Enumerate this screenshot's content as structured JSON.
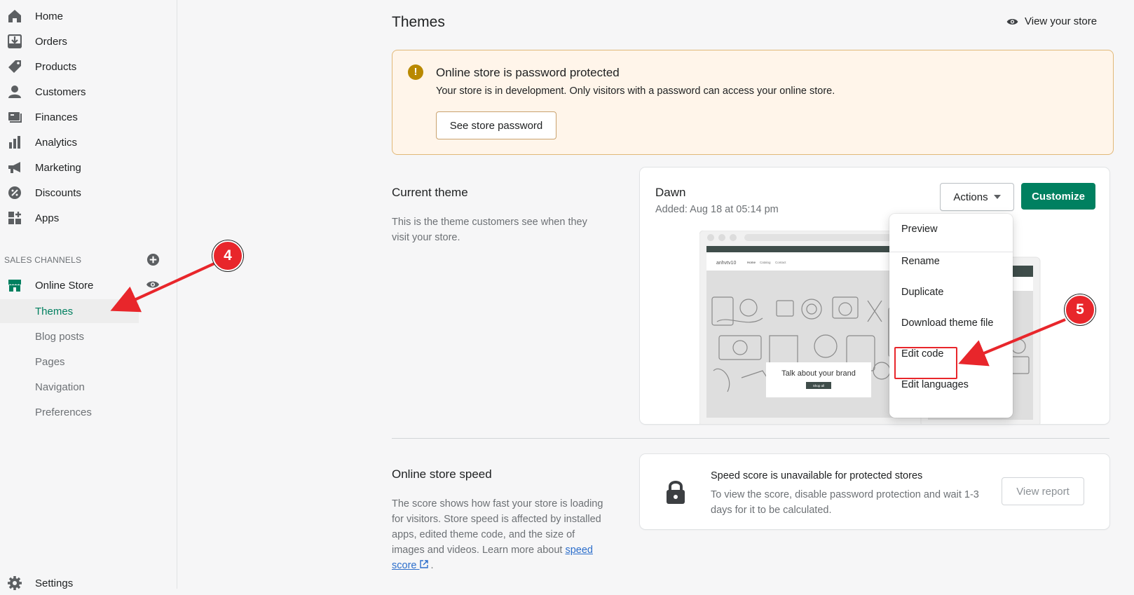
{
  "sidebar": {
    "items": [
      {
        "label": "Home",
        "icon": "home-icon"
      },
      {
        "label": "Orders",
        "icon": "orders-icon"
      },
      {
        "label": "Products",
        "icon": "tag-icon"
      },
      {
        "label": "Customers",
        "icon": "person-icon"
      },
      {
        "label": "Finances",
        "icon": "finances-icon"
      },
      {
        "label": "Analytics",
        "icon": "bar-chart-icon"
      },
      {
        "label": "Marketing",
        "icon": "megaphone-icon"
      },
      {
        "label": "Discounts",
        "icon": "discount-icon"
      },
      {
        "label": "Apps",
        "icon": "apps-icon"
      }
    ],
    "sales_channels_label": "SALES CHANNELS",
    "online_store_label": "Online Store",
    "sub_items": [
      "Themes",
      "Blog posts",
      "Pages",
      "Navigation",
      "Preferences"
    ],
    "active_sub_item": "Themes",
    "settings_label": "Settings"
  },
  "header": {
    "title": "Themes",
    "view_store_label": "View your store"
  },
  "banner": {
    "title": "Online store is password protected",
    "text": "Your store is in development. Only visitors with a password can access your online store.",
    "button_label": "See store password"
  },
  "current_theme": {
    "heading": "Current theme",
    "description": "This is the theme customers see when they visit your store.",
    "theme_name": "Dawn",
    "added": "Added: Aug 18 at 05:14 pm",
    "actions_label": "Actions",
    "customize_label": "Customize",
    "preview": {
      "store_name": "anhvtv10",
      "nav": [
        "Home",
        "Catalog",
        "Contact"
      ],
      "hero_text": "Talk about your brand",
      "hero_button": "Shop all",
      "announcement": "Welcome to our store"
    }
  },
  "actions_menu": {
    "items": [
      "Preview",
      "Rename",
      "Duplicate",
      "Download theme file",
      "Edit code",
      "Edit languages"
    ],
    "highlighted": "Edit code"
  },
  "speed": {
    "heading": "Online store speed",
    "description": "The score shows how fast your store is loading for visitors. Store speed is affected by installed apps, edited theme code, and the size of images and videos. Learn more about",
    "link_label": "speed score",
    "link_suffix": ".",
    "card_title": "Speed score is unavailable for protected stores",
    "card_text": "To view the score, disable password protection and wait 1-3 days for it to be calculated.",
    "button_label": "View report"
  },
  "annotations": {
    "step_4": "4",
    "step_5": "5",
    "color": "#e8262b"
  },
  "colors": {
    "accent": "#008060",
    "active_text": "#007f5f",
    "warning": "#b98900"
  }
}
